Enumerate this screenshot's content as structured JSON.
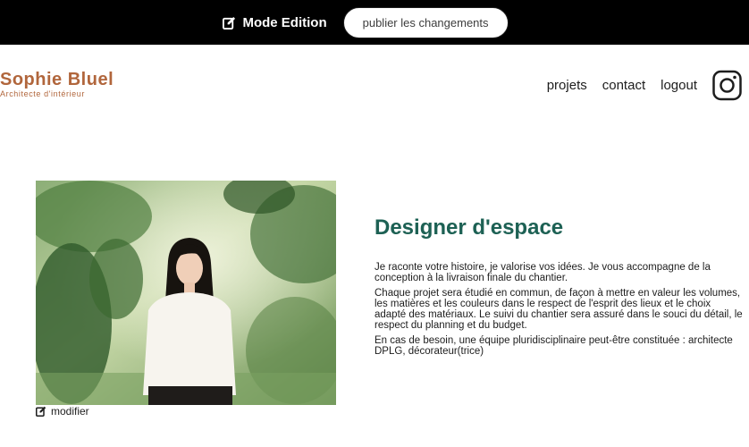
{
  "edit_bar": {
    "mode_label": "Mode Edition",
    "publish_label": "publier les changements"
  },
  "brand": {
    "name": "Sophie Bluel",
    "subtitle": "Architecte d'intérieur"
  },
  "nav": {
    "items": [
      "projets",
      "contact",
      "logout"
    ],
    "instagram_icon": "instagram-icon"
  },
  "intro": {
    "title": "Designer d'espace",
    "paragraphs": [
      "Je raconte votre histoire, je valorise vos idées. Je vous accompagne de la conception à la livraison finale du chantier.",
      "Chaque projet sera étudié en commun, de façon à mettre en valeur les volumes, les matières et les couleurs dans le respect de l'esprit des lieux et le choix adapté des matériaux. Le suivi du chantier sera assuré dans le souci du détail, le respect du planning et du budget.",
      "En cas de besoin, une équipe pluridisciplinaire peut-être constituée : architecte DPLG, décorateur(trice)"
    ]
  },
  "photo": {
    "modify_label": "modifier"
  },
  "colors": {
    "brand": "#b1663c",
    "heading": "#1d6154",
    "edit_bar_bg": "#000000"
  }
}
